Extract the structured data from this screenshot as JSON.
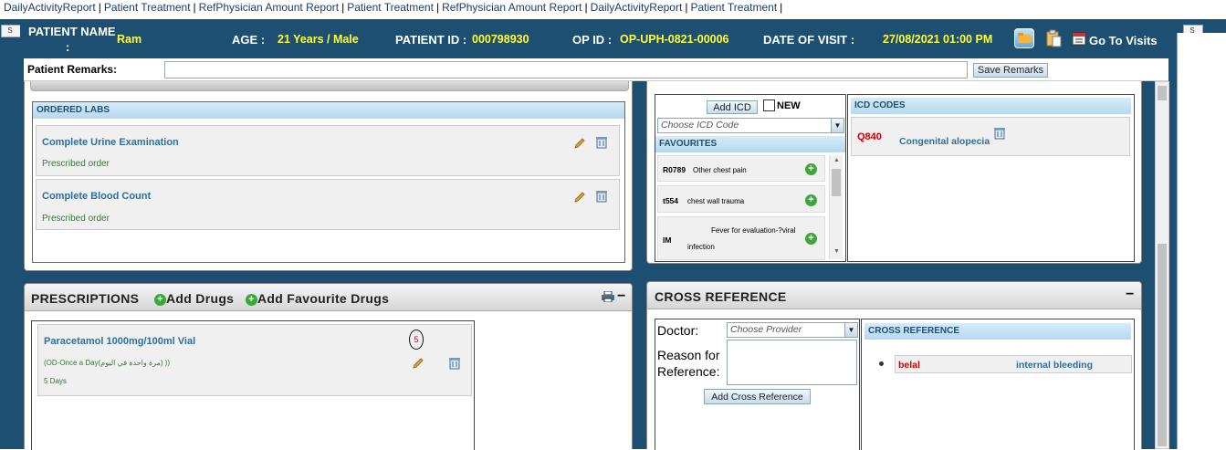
{
  "topnav": {
    "links": [
      "DailyActivityReport",
      "Patient Treatment",
      "RefPhysician Amount Report",
      "Patient Treatment",
      "RefPhysician Amount Report",
      "DailyActivityReport",
      "Patient Treatment"
    ],
    "sep": "|"
  },
  "side_tab": {
    "label": "S"
  },
  "patient": {
    "name_label": "PATIENT NAME",
    "name_colon": ":",
    "name": "Ram",
    "age_label": "AGE :",
    "age": "21 Years / Male",
    "id_label": "PATIENT ID :",
    "id": "000798930",
    "op_label": "OP ID :",
    "op": "OP-UPH-0821-00006",
    "date_label": "DATE OF VISIT :",
    "date": "27/08/2021 01:00 PM",
    "goto_visits": "Go To Visits"
  },
  "remarks": {
    "label": "Patient Remarks:",
    "value": "",
    "save_label": "Save Remarks"
  },
  "labs": {
    "header": "ORDERED LABS",
    "items": [
      {
        "name": "Complete Urine Examination",
        "status": "Prescribed order"
      },
      {
        "name": "Complete Blood Count",
        "status": "Prescribed order"
      }
    ]
  },
  "icd": {
    "add_label": "Add ICD",
    "new_label": "NEW",
    "choose_placeholder": "Choose ICD Code",
    "favourites_header": "FAVOURITES",
    "favourites": [
      {
        "code": "R0789",
        "desc": "Other chest pain"
      },
      {
        "code": "t554",
        "desc": "chest wall trauma"
      },
      {
        "code": "IM",
        "desc_line1": "Fever for evaluation-?viral",
        "desc_line2": "infection"
      }
    ],
    "codes_header": "ICD CODES",
    "codes": [
      {
        "code": "Q840",
        "desc": "Congenital alopecia"
      }
    ]
  },
  "prescriptions": {
    "title": "PRESCRIPTIONS",
    "add_drugs": "Add Drugs",
    "add_fav_drugs": "Add Favourite Drugs",
    "minus": "−",
    "items": [
      {
        "name": "Paracetamol 1000mg/100ml Vial",
        "badge": "5",
        "dosage": "(OD-Once a Day(مرة واحدة في اليوم) ))",
        "duration": "5 Days"
      }
    ]
  },
  "cross_ref": {
    "title": "CROSS REFERENCE",
    "minus": "−",
    "doctor_label": "Doctor:",
    "doctor_placeholder": "Choose Provider",
    "reason_label_1": "Reason for",
    "reason_label_2": "Reference:",
    "add_label": "Add Cross Reference",
    "list_header": "CROSS REFERENCE",
    "entries": [
      {
        "doctor": "belal",
        "reason": "internal bleeding"
      }
    ]
  },
  "colors": {
    "frame": "#1c4f72",
    "highlight": "#ffff33",
    "link": "#2b6fa3",
    "code_red": "#cc0000",
    "green": "#2e7d32"
  }
}
